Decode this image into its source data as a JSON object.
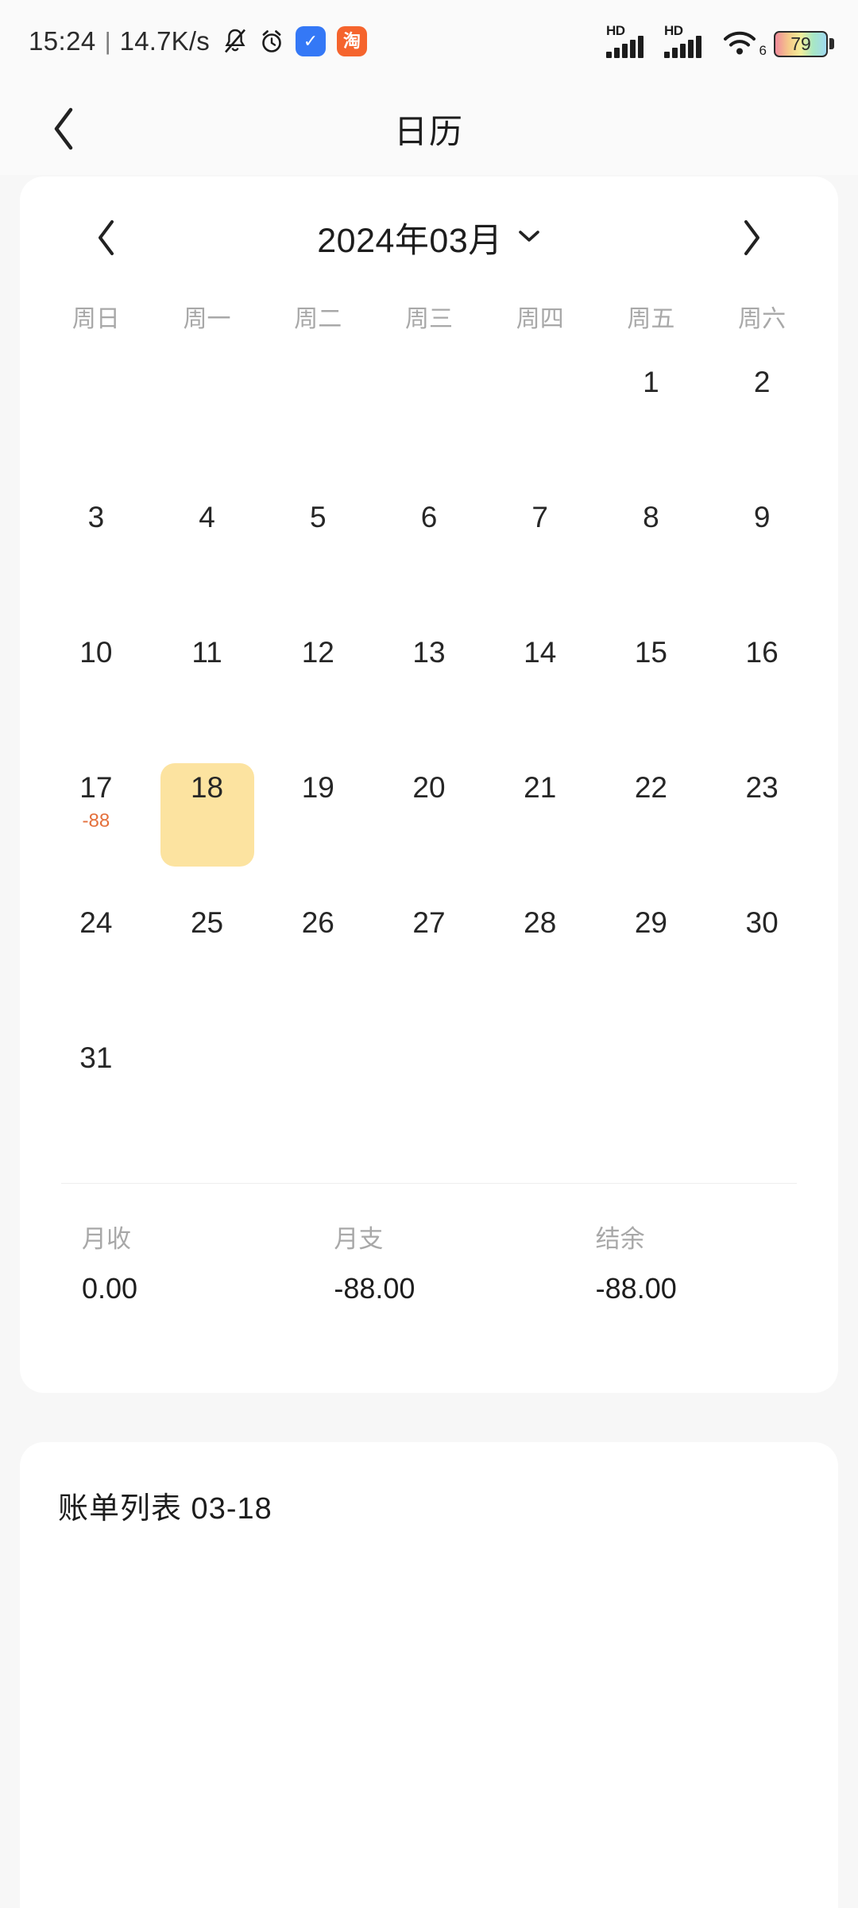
{
  "status_bar": {
    "time": "15:24",
    "separator": "|",
    "network_speed": "14.7K/s",
    "icons": [
      {
        "name": "bell-muted-icon",
        "label": "静音"
      },
      {
        "name": "alarm-clock-icon",
        "label": "闹钟"
      },
      {
        "name": "app-icon-blue",
        "label": "✓"
      },
      {
        "name": "app-icon-taobao",
        "label": "淘"
      }
    ],
    "signal_1_label": "HD",
    "signal_2_label": "HD",
    "wifi_generation": "6",
    "battery_percent": "79"
  },
  "title_bar": {
    "back_label": "返回",
    "title": "日历"
  },
  "calendar": {
    "prev_label": "上一月",
    "next_label": "下一月",
    "month_title": "2024年03月",
    "dropdown_label": "选择月份",
    "weekdays": [
      "周日",
      "周一",
      "周二",
      "周三",
      "周四",
      "周五",
      "周六"
    ],
    "leading_blanks": 5,
    "days": [
      {
        "day": "1",
        "amount": "",
        "selected": false
      },
      {
        "day": "2",
        "amount": "",
        "selected": false
      },
      {
        "day": "3",
        "amount": "",
        "selected": false
      },
      {
        "day": "4",
        "amount": "",
        "selected": false
      },
      {
        "day": "5",
        "amount": "",
        "selected": false
      },
      {
        "day": "6",
        "amount": "",
        "selected": false
      },
      {
        "day": "7",
        "amount": "",
        "selected": false
      },
      {
        "day": "8",
        "amount": "",
        "selected": false
      },
      {
        "day": "9",
        "amount": "",
        "selected": false
      },
      {
        "day": "10",
        "amount": "",
        "selected": false
      },
      {
        "day": "11",
        "amount": "",
        "selected": false
      },
      {
        "day": "12",
        "amount": "",
        "selected": false
      },
      {
        "day": "13",
        "amount": "",
        "selected": false
      },
      {
        "day": "14",
        "amount": "",
        "selected": false
      },
      {
        "day": "15",
        "amount": "",
        "selected": false
      },
      {
        "day": "16",
        "amount": "",
        "selected": false
      },
      {
        "day": "17",
        "amount": "-88",
        "selected": false
      },
      {
        "day": "18",
        "amount": "",
        "selected": true
      },
      {
        "day": "19",
        "amount": "",
        "selected": false
      },
      {
        "day": "20",
        "amount": "",
        "selected": false
      },
      {
        "day": "21",
        "amount": "",
        "selected": false
      },
      {
        "day": "22",
        "amount": "",
        "selected": false
      },
      {
        "day": "23",
        "amount": "",
        "selected": false
      },
      {
        "day": "24",
        "amount": "",
        "selected": false
      },
      {
        "day": "25",
        "amount": "",
        "selected": false
      },
      {
        "day": "26",
        "amount": "",
        "selected": false
      },
      {
        "day": "27",
        "amount": "",
        "selected": false
      },
      {
        "day": "28",
        "amount": "",
        "selected": false
      },
      {
        "day": "29",
        "amount": "",
        "selected": false
      },
      {
        "day": "30",
        "amount": "",
        "selected": false
      },
      {
        "day": "31",
        "amount": "",
        "selected": false
      }
    ],
    "summary": [
      {
        "label": "月收",
        "value": "0.00"
      },
      {
        "label": "月支",
        "value": "-88.00"
      },
      {
        "label": "结余",
        "value": "-88.00"
      }
    ]
  },
  "bill_list": {
    "header": "账单列表 03-18",
    "items": []
  },
  "colors": {
    "page_background": "#f7f7f7",
    "card_background": "#ffffff",
    "selected_day": "#fce3a0",
    "expense_orange": "#e4703c",
    "text_primary": "#1d1d1d",
    "text_muted": "#a8a8a8",
    "divider": "#eeeeee"
  }
}
